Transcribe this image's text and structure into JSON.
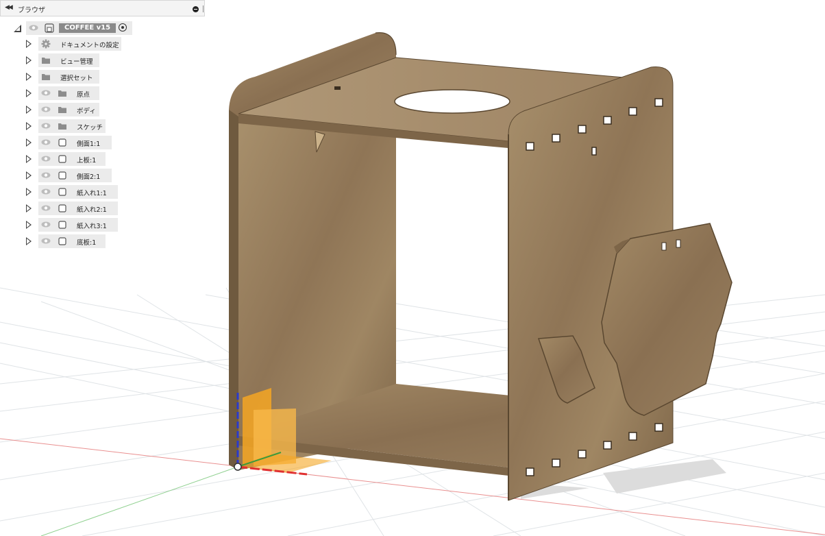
{
  "browser": {
    "title": "ブラウザ",
    "root": {
      "label": "COFFEE v15"
    },
    "items": [
      {
        "label": "ドキュメントの設定",
        "icon": "gear-icon",
        "visible": false
      },
      {
        "label": "ビュー管理",
        "icon": "folder-icon",
        "visible": false
      },
      {
        "label": "選択セット",
        "icon": "folder-icon",
        "visible": false
      },
      {
        "label": "原点",
        "icon": "folder-icon",
        "visible": true
      },
      {
        "label": "ボディ",
        "icon": "folder-icon",
        "visible": true
      },
      {
        "label": "スケッチ",
        "icon": "folder-icon",
        "visible": true
      },
      {
        "label": "側面1:1",
        "icon": "component-icon",
        "visible": true
      },
      {
        "label": "上板:1",
        "icon": "component-icon",
        "visible": true
      },
      {
        "label": "側面2:1",
        "icon": "component-icon",
        "visible": true
      },
      {
        "label": "紙入れ1:1",
        "icon": "component-icon",
        "visible": true
      },
      {
        "label": "紙入れ2:1",
        "icon": "component-icon",
        "visible": true
      },
      {
        "label": "紙入れ3:1",
        "icon": "component-icon",
        "visible": true
      },
      {
        "label": "底板:1",
        "icon": "component-icon",
        "visible": true
      }
    ]
  },
  "colors": {
    "wood": "#9c8160",
    "wood_dark": "#6f5a3f",
    "grid": "#d9dde1",
    "axis_x": "#e03030",
    "axis_y": "#3c9a3c",
    "axis_z": "#2a3acc",
    "origin_plane": "#f5a623"
  }
}
